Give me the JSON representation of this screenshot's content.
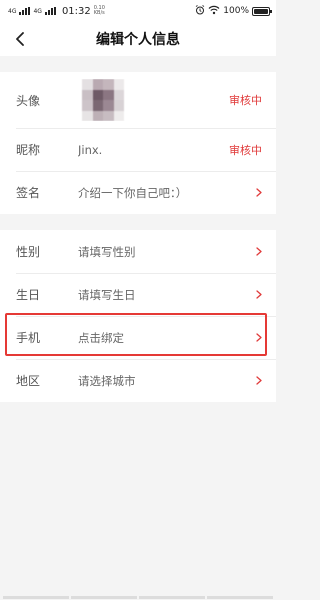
{
  "status_bar": {
    "network_1": "4G",
    "network_2": "4G",
    "time": "01:32",
    "speed_value": "0.10",
    "speed_unit": "KB/s",
    "battery": "100%",
    "battery_level": 1.0
  },
  "nav": {
    "title": "编辑个人信息"
  },
  "profile": {
    "avatar": {
      "label": "头像",
      "status": "审核中"
    },
    "nickname": {
      "label": "昵称",
      "value": "Jinx.",
      "status": "审核中"
    },
    "signature": {
      "label": "签名",
      "value": "介绍一下你自己吧：）"
    }
  },
  "details": {
    "gender": {
      "label": "性别",
      "value": "请填写性别"
    },
    "birthday": {
      "label": "生日",
      "value": "请填写生日"
    },
    "phone": {
      "label": "手机",
      "value": "点击绑定"
    },
    "region": {
      "label": "地区",
      "value": "请选择城市"
    }
  },
  "colors": {
    "accent_red": "#e03a3a",
    "highlight_border": "#e53935",
    "page_bg": "#f4f4f4"
  }
}
